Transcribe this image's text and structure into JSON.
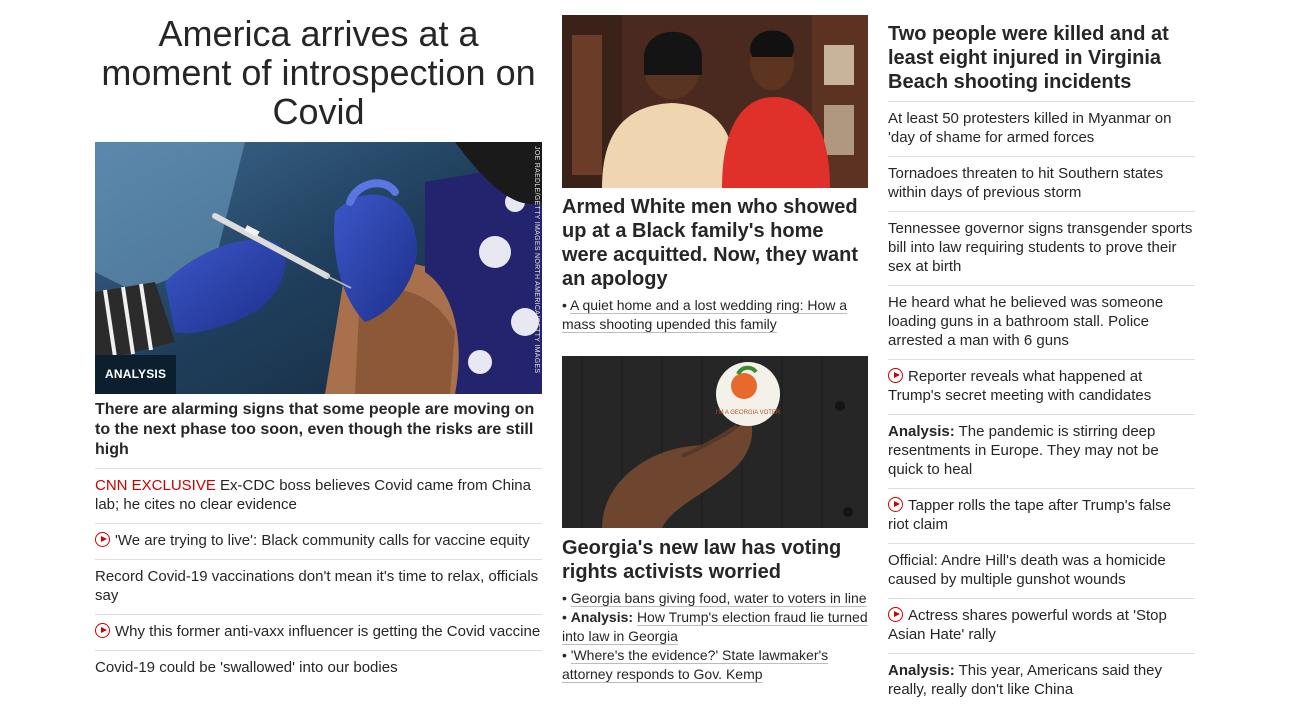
{
  "col1": {
    "headline": "America arrives at a moment of introspection on Covid",
    "image_badge": "ANALYSIS",
    "image_credit": "JOE RAEDLE/GETTY IMAGES NORTH AMERICA/GETTY IMAGES",
    "caption": "There are alarming signs that some people are moving on to the next phase too soon, even though the risks are still high",
    "items": [
      {
        "prefix": "CNN EXCLUSIVE",
        "text": " Ex-CDC boss believes Covid came from China lab; he cites no clear evidence",
        "icon": ""
      },
      {
        "prefix": "",
        "text": "'We are trying to live': Black community calls for vaccine equity",
        "icon": "play-video-icon"
      },
      {
        "prefix": "",
        "text": "Record Covid-19 vaccinations don't mean it's time to relax, officials say",
        "icon": ""
      },
      {
        "prefix": "",
        "text": "Why this former anti-vaxx influencer is getting the Covid vaccine",
        "icon": "play-video-icon"
      },
      {
        "prefix": "",
        "text": "Covid-19 could be 'swallowed' into our bodies",
        "icon": ""
      }
    ]
  },
  "col2": {
    "story1": {
      "headline": "Armed White men who showed up at a Black family's home were acquitted. Now, they want an apology",
      "sublink": "A quiet home and a lost wedding ring: How a mass shooting upended this family"
    },
    "story2": {
      "sticker_text": "I'M A GEORGIA VOTER",
      "headline": "Georgia's new law has voting rights activists worried",
      "sublinks": [
        {
          "prefix": "",
          "text": "Georgia bans giving food, water to voters in line"
        },
        {
          "prefix": "Analysis:",
          "text": "How Trump's election fraud lie turned into law in Georgia"
        },
        {
          "prefix": "",
          "text": "'Where's the evidence?' State lawmaker's attorney responds to Gov. Kemp"
        }
      ]
    }
  },
  "col3": {
    "headline": "Two people were killed and at least eight injured in Virginia Beach shooting incidents",
    "items": [
      {
        "prefix": "",
        "text": "At least 50 protesters killed in Myanmar on 'day of shame for armed forces",
        "icon": ""
      },
      {
        "prefix": "",
        "text": "Tornadoes threaten to hit Southern states within days of previous storm",
        "icon": ""
      },
      {
        "prefix": "",
        "text": "Tennessee governor signs transgender sports bill into law requiring students to prove their sex at birth",
        "icon": ""
      },
      {
        "prefix": "",
        "text": "He heard what he believed was someone loading guns in a bathroom stall. Police arrested a man with 6 guns",
        "icon": ""
      },
      {
        "prefix": "",
        "text": "Reporter reveals what happened at Trump's secret meeting with candidates",
        "icon": "play-video-icon"
      },
      {
        "prefix": "Analysis:",
        "text": " The pandemic is stirring deep resentments in Europe. They may not be quick to heal",
        "icon": ""
      },
      {
        "prefix": "",
        "text": "Tapper rolls the tape after Trump's false riot claim",
        "icon": "play-video-icon"
      },
      {
        "prefix": "",
        "text": "Official: Andre Hill's death was a homicide caused by multiple gunshot wounds",
        "icon": ""
      },
      {
        "prefix": "",
        "text": "Actress shares powerful words at 'Stop Asian Hate' rally",
        "icon": "play-video-icon"
      },
      {
        "prefix": "Analysis:",
        "text": " This year, Americans said they really, really don't like China",
        "icon": ""
      }
    ]
  },
  "colors": {
    "accent_red": "#cc0000",
    "badge_bg": "#0c1f2e",
    "divider": "#dedede",
    "text": "#262626"
  }
}
